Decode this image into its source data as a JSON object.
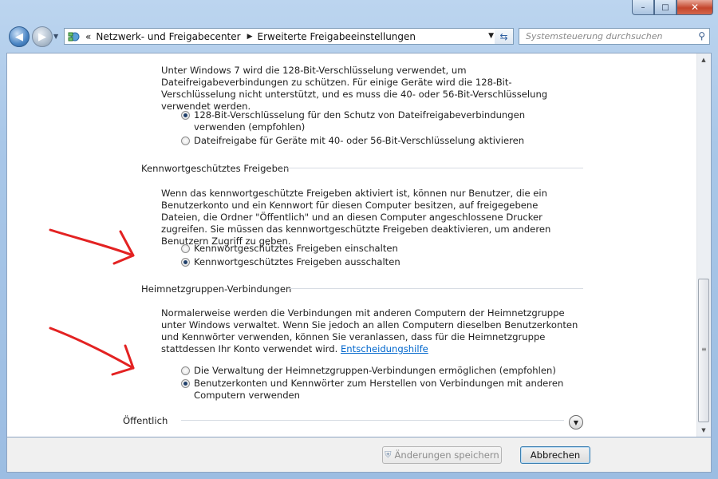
{
  "window": {
    "minimize_glyph": "–",
    "maximize_glyph": "□",
    "close_glyph": "✕"
  },
  "nav": {
    "breadcrumb_prefix": "«",
    "crumb1": "Netzwerk- und Freigabecenter",
    "crumb2": "Erweiterte Freigabeeinstellungen",
    "search_placeholder": "Systemsteuerung durchsuchen"
  },
  "encryption": {
    "text": "Unter Windows 7 wird die 128-Bit-Verschlüsselung verwendet, um Dateifreigabeverbindungen zu schützen. Für einige Geräte wird die 128-Bit-Verschlüsselung nicht unterstützt, und es muss die 40- oder 56-Bit-Verschlüsselung verwendet werden.",
    "option1": "128-Bit-Verschlüsselung für den Schutz von Dateifreigabeverbindungen verwenden (empfohlen)",
    "option2": "Dateifreigabe für Geräte mit 40- oder 56-Bit-Verschlüsselung aktivieren"
  },
  "password_sharing": {
    "heading": "Kennwortgeschütztes Freigeben",
    "text": "Wenn das kennwortgeschützte Freigeben aktiviert ist, können nur Benutzer, die ein Benutzerkonto und ein Kennwort für diesen Computer besitzen, auf freigegebene Dateien, die Ordner \"Öffentlich\" und an diesen Computer angeschlossene Drucker zugreifen. Sie müssen das kennwortgeschützte Freigeben deaktivieren, um anderen Benutzern Zugriff zu geben.",
    "option1": "Kennwortgeschütztes Freigeben einschalten",
    "option2": "Kennwortgeschütztes Freigeben ausschalten"
  },
  "homegroup": {
    "heading": "Heimnetzgruppen-Verbindungen",
    "text": "Normalerweise werden die Verbindungen mit anderen Computern der Heimnetzgruppe unter Windows verwaltet. Wenn Sie jedoch an allen Computern dieselben Benutzerkonten und Kennwörter verwenden, können Sie veranlassen, dass für die Heimnetzgruppe stattdessen Ihr Konto verwendet wird.",
    "link": "Entscheidungshilfe",
    "option1": "Die Verwaltung der Heimnetzgruppen-Verbindungen ermöglichen (empfohlen)",
    "option2": "Benutzerkonten und Kennwörter zum Herstellen von Verbindungen mit anderen Computern verwenden"
  },
  "public": {
    "heading": "Öffentlich"
  },
  "buttons": {
    "save": "Änderungen speichern",
    "cancel": "Abbrechen"
  },
  "colors": {
    "annotation_arrow": "#e32222",
    "link": "#0066cc"
  },
  "icons": {
    "back": "arrow-left-icon",
    "forward": "arrow-right-icon",
    "network": "network-icon",
    "refresh": "refresh-icon",
    "search": "search-icon",
    "shield": "uac-shield-icon",
    "expand": "chevron-down-icon"
  }
}
